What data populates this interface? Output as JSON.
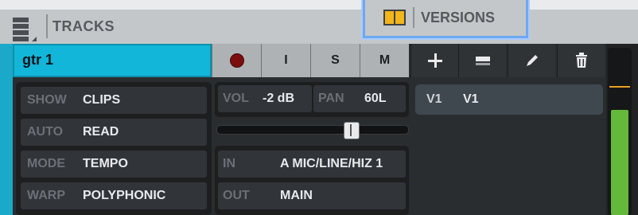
{
  "header": {
    "tracks_label": "TRACKS",
    "versions_label": "VERSIONS"
  },
  "track": {
    "name": "gtr 1",
    "buttons": [
      {
        "label": "",
        "icon": "record-icon"
      },
      {
        "label": "I"
      },
      {
        "label": "S"
      },
      {
        "label": "M"
      }
    ]
  },
  "actions": [
    "add-icon",
    "collapse-icon",
    "pencil-icon",
    "trash-icon"
  ],
  "settings": {
    "show_label": "SHOW",
    "show_value": "CLIPS",
    "auto_label": "AUTO",
    "auto_value": "READ",
    "mode_label": "MODE",
    "mode_value": "TEMPO",
    "warp_label": "WARP",
    "warp_value": "POLYPHONIC"
  },
  "mixer": {
    "vol_label": "VOL",
    "vol_value": "-2 dB",
    "pan_label": "PAN",
    "pan_value": "60L",
    "pan_slider_fraction": 0.72
  },
  "io": {
    "in_label": "IN",
    "in_value": "A MIC/LINE/HIZ 1",
    "out_label": "OUT",
    "out_value": "MAIN"
  },
  "versions": {
    "items": [
      {
        "id": "V1",
        "name": "V1"
      }
    ]
  },
  "colors": {
    "track_accent": "#12b6d9",
    "record": "#7a0d0d",
    "meter": "#63b93a",
    "highlight": "#6ea8f4"
  }
}
